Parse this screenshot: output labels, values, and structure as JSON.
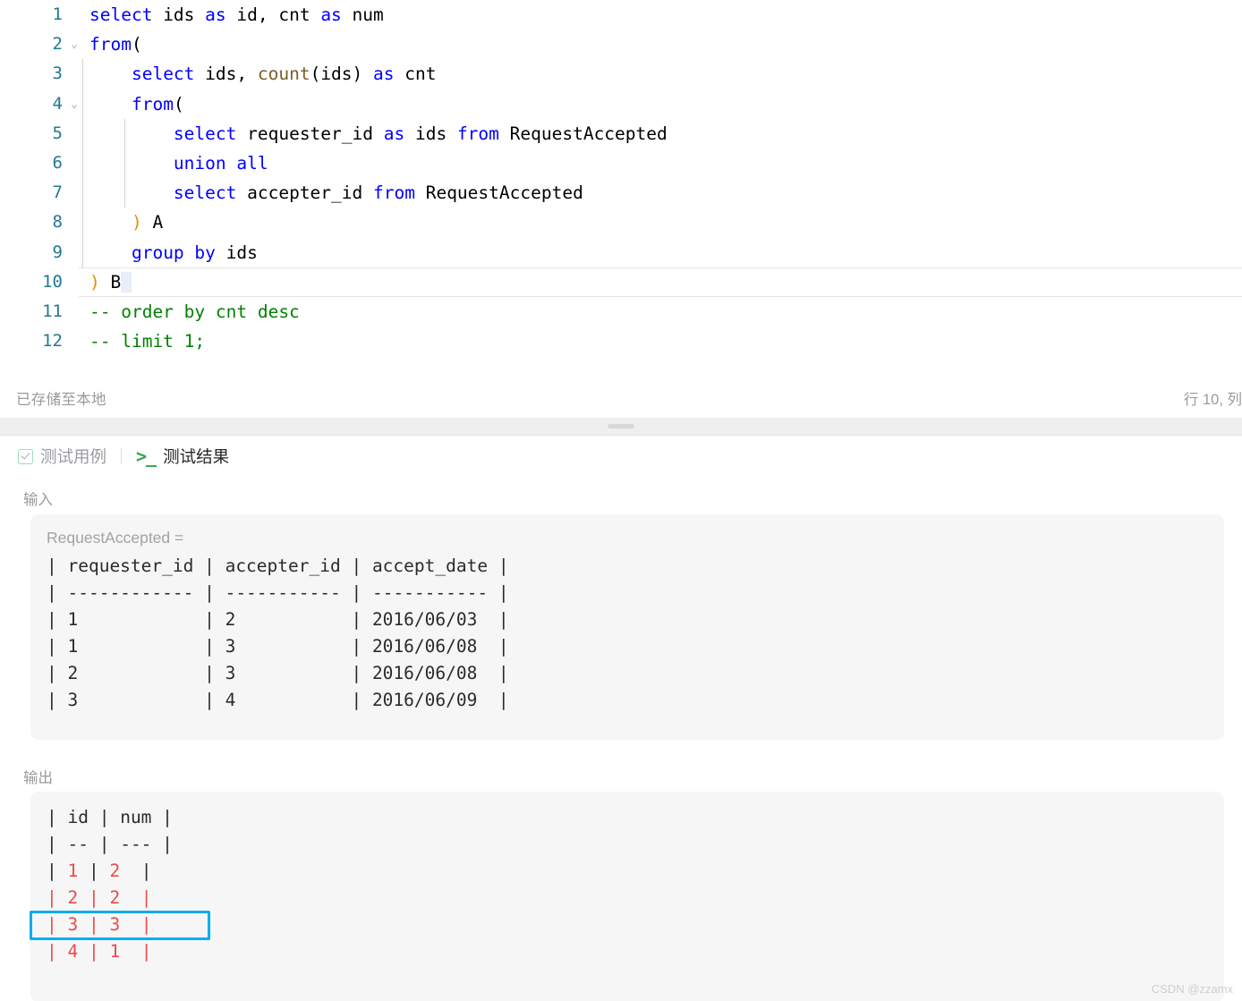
{
  "editor": {
    "lines": [
      {
        "num": "1",
        "fold": "",
        "indent_guides": 0,
        "tokens": [
          {
            "t": "select",
            "c": "kw"
          },
          {
            "t": " ids ",
            "c": "idt"
          },
          {
            "t": "as",
            "c": "kw"
          },
          {
            "t": " id, cnt ",
            "c": "idt"
          },
          {
            "t": "as",
            "c": "kw"
          },
          {
            "t": " num",
            "c": "idt"
          }
        ]
      },
      {
        "num": "2",
        "fold": "v",
        "indent_guides": 0,
        "tokens": [
          {
            "t": "from",
            "c": "kw"
          },
          {
            "t": "(",
            "c": "idt"
          }
        ]
      },
      {
        "num": "3",
        "fold": "",
        "indent_guides": 1,
        "tokens": [
          {
            "t": "    ",
            "c": "idt"
          },
          {
            "t": "select",
            "c": "kw"
          },
          {
            "t": " ids, ",
            "c": "idt"
          },
          {
            "t": "count",
            "c": "fn"
          },
          {
            "t": "(ids) ",
            "c": "idt"
          },
          {
            "t": "as",
            "c": "kw"
          },
          {
            "t": " cnt",
            "c": "idt"
          }
        ]
      },
      {
        "num": "4",
        "fold": "v",
        "indent_guides": 1,
        "tokens": [
          {
            "t": "    ",
            "c": "idt"
          },
          {
            "t": "from",
            "c": "kw"
          },
          {
            "t": "(",
            "c": "idt"
          }
        ]
      },
      {
        "num": "5",
        "fold": "",
        "indent_guides": 2,
        "tokens": [
          {
            "t": "        ",
            "c": "idt"
          },
          {
            "t": "select",
            "c": "kw"
          },
          {
            "t": " requester_id ",
            "c": "idt"
          },
          {
            "t": "as",
            "c": "kw"
          },
          {
            "t": " ids ",
            "c": "idt"
          },
          {
            "t": "from",
            "c": "kw"
          },
          {
            "t": " RequestAccepted",
            "c": "idt"
          }
        ]
      },
      {
        "num": "6",
        "fold": "",
        "indent_guides": 2,
        "tokens": [
          {
            "t": "        ",
            "c": "idt"
          },
          {
            "t": "union all",
            "c": "kw"
          }
        ]
      },
      {
        "num": "7",
        "fold": "",
        "indent_guides": 2,
        "tokens": [
          {
            "t": "        ",
            "c": "idt"
          },
          {
            "t": "select",
            "c": "kw"
          },
          {
            "t": " accepter_id ",
            "c": "idt"
          },
          {
            "t": "from",
            "c": "kw"
          },
          {
            "t": " RequestAccepted",
            "c": "idt"
          }
        ]
      },
      {
        "num": "8",
        "fold": "",
        "indent_guides": 1,
        "tokens": [
          {
            "t": "    ",
            "c": "idt"
          },
          {
            "t": ")",
            "c": "brk"
          },
          {
            "t": " A",
            "c": "idt"
          }
        ]
      },
      {
        "num": "9",
        "fold": "",
        "indent_guides": 1,
        "tokens": [
          {
            "t": "    ",
            "c": "idt"
          },
          {
            "t": "group by",
            "c": "kw"
          },
          {
            "t": " ids",
            "c": "idt"
          }
        ]
      },
      {
        "num": "10",
        "fold": "",
        "indent_guides": 0,
        "current": true,
        "tokens": [
          {
            "t": ")",
            "c": "brk"
          },
          {
            "t": " B",
            "c": "idt"
          }
        ]
      },
      {
        "num": "11",
        "fold": "",
        "indent_guides": 0,
        "tokens": [
          {
            "t": "-- order by cnt desc",
            "c": "cmt"
          }
        ]
      },
      {
        "num": "12",
        "fold": "",
        "indent_guides": 0,
        "tokens": [
          {
            "t": "-- limit 1;",
            "c": "cmt"
          }
        ]
      }
    ]
  },
  "status_bar": {
    "saved_text": "已存储至本地",
    "cursor_position": "行 10, 列"
  },
  "tabs": [
    {
      "label": "测试用例",
      "icon": "checkbox-icon",
      "active": false
    },
    {
      "label": "测试结果",
      "icon": "terminal-icon",
      "active": true
    }
  ],
  "input_section": {
    "label": "输入",
    "table_title": "RequestAccepted =",
    "rows": [
      "| requester_id | accepter_id | accept_date |",
      "| ------------ | ----------- | ----------- |",
      "| 1            | 2           | 2016/06/03  |",
      "| 1            | 3           | 2016/06/08  |",
      "| 2            | 3           | 2016/06/08  |",
      "| 3            | 4           | 2016/06/09  |"
    ]
  },
  "output_section": {
    "label": "输出",
    "rows": [
      {
        "cells": [
          {
            "t": "| ",
            "c": "k"
          },
          {
            "t": "id",
            "c": "k"
          },
          {
            "t": " | ",
            "c": "k"
          },
          {
            "t": "num",
            "c": "k"
          },
          {
            "t": " |",
            "c": "k"
          }
        ]
      },
      {
        "cells": [
          {
            "t": "| ",
            "c": "k"
          },
          {
            "t": "--",
            "c": "k"
          },
          {
            "t": " | ",
            "c": "k"
          },
          {
            "t": "---",
            "c": "k"
          },
          {
            "t": " |",
            "c": "k"
          }
        ]
      },
      {
        "cells": [
          {
            "t": "| ",
            "c": "k"
          },
          {
            "t": "1 ",
            "c": "r"
          },
          {
            "t": "| ",
            "c": "k"
          },
          {
            "t": "2  ",
            "c": "r"
          },
          {
            "t": "|",
            "c": "k"
          }
        ]
      },
      {
        "cells": [
          {
            "t": "| ",
            "c": "r"
          },
          {
            "t": "2 ",
            "c": "r"
          },
          {
            "t": "| ",
            "c": "r"
          },
          {
            "t": "2  ",
            "c": "r"
          },
          {
            "t": "|",
            "c": "r"
          }
        ]
      },
      {
        "cells": [
          {
            "t": "| ",
            "c": "r"
          },
          {
            "t": "3 ",
            "c": "r"
          },
          {
            "t": "| ",
            "c": "r"
          },
          {
            "t": "3  ",
            "c": "r"
          },
          {
            "t": "|",
            "c": "r"
          }
        ],
        "highlighted": true
      },
      {
        "cells": [
          {
            "t": "| ",
            "c": "r"
          },
          {
            "t": "4 ",
            "c": "r"
          },
          {
            "t": "| ",
            "c": "r"
          },
          {
            "t": "1  ",
            "c": "r"
          },
          {
            "t": "|",
            "c": "r"
          }
        ]
      }
    ]
  },
  "watermark": "CSDN @zzamx",
  "colors": {
    "keyword": "#0000ff",
    "function": "#795e26",
    "comment": "#008000",
    "bracket": "#e08f00",
    "line_number": "#237893",
    "output_red": "#ec4a4a",
    "highlight_cyan": "#00aeef",
    "panel_bg": "#f6f6f7",
    "tab_green": "#2ea44f"
  }
}
